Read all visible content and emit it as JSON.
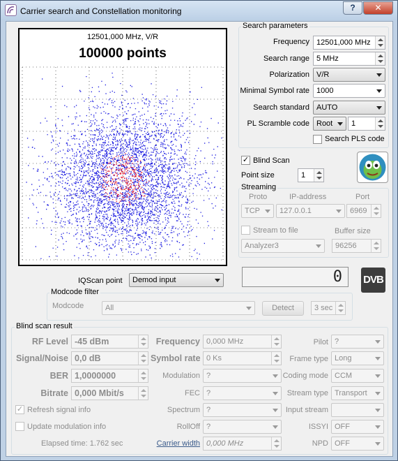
{
  "window": {
    "title": "Carrier search and Constellation monitoring",
    "help_label": "?",
    "close_label": "✕"
  },
  "plot": {
    "frequency_label": "12501,000 MHz, V/R",
    "points_label": "100000 points"
  },
  "search": {
    "legend": "Search parameters",
    "frequency_label": "Frequency",
    "frequency_value": "12501,000 MHz",
    "range_label": "Search range",
    "range_value": "5 MHz",
    "polarization_label": "Polarization",
    "polarization_value": "V/R",
    "symbol_rate_label": "Minimal Symbol rate",
    "symbol_rate_value": "1000",
    "standard_label": "Search standard",
    "standard_value": "AUTO",
    "pls_label": "PL Scramble code",
    "pls_mode": "Root",
    "pls_value": "1",
    "search_pls_label": "Search PLS code",
    "search_pls_checked": false
  },
  "blind_scan": {
    "label": "Blind Scan",
    "checked": true,
    "point_size_label": "Point size",
    "point_size_value": "1"
  },
  "streaming": {
    "legend": "Streaming",
    "proto_header": "Proto",
    "ip_header": "IP-address",
    "port_header": "Port",
    "proto_value": "TCP",
    "ip_value": "127.0.0.1",
    "port_value": "6969",
    "stream_to_file_label": "Stream to file",
    "stream_to_file_checked": false,
    "buffer_size_label": "Buffer size",
    "file_value": "Analyzer3",
    "buffer_value": "96256"
  },
  "iqscan": {
    "label": "IQScan point",
    "value": "Demod input"
  },
  "lcd": {
    "value": "0"
  },
  "dvb_logo": "DVB",
  "modcode": {
    "legend": "Modcode filter",
    "label": "Modcode",
    "value": "All",
    "detect_label": "Detect",
    "interval_value": "3 sec"
  },
  "result": {
    "legend": "Blind scan result",
    "rf_level_label": "RF Level",
    "rf_level_value": "-45 dBm",
    "snr_label": "Signal/Noise",
    "snr_value": "0,0 dB",
    "ber_label": "BER",
    "ber_value": "1,0000000",
    "bitrate_label": "Bitrate",
    "bitrate_value": "0,000 Mbit/s",
    "frequency_label": "Frequency",
    "frequency_value": "0,000 MHz",
    "symbol_rate_label": "Symbol rate",
    "symbol_rate_value": "0 Ks",
    "modulation_label": "Modulation",
    "modulation_value": "?",
    "fec_label": "FEC",
    "fec_value": "?",
    "spectrum_label": "Spectrum",
    "spectrum_value": "?",
    "rolloff_label": "RollOff",
    "rolloff_value": "?",
    "carrier_width_label": "Carrier width",
    "carrier_width_value": "0,000 MHz",
    "pilot_label": "Pilot",
    "pilot_value": "?",
    "frame_type_label": "Frame type",
    "frame_type_value": "Long",
    "coding_mode_label": "Coding mode",
    "coding_mode_value": "CCM",
    "stream_type_label": "Stream type",
    "stream_type_value": "Transport",
    "input_stream_label": "Input stream",
    "input_stream_value": "",
    "issyi_label": "ISSYI",
    "issyi_value": "OFF",
    "npd_label": "NPD",
    "npd_value": "OFF",
    "refresh_label": "Refresh signal info",
    "refresh_checked": true,
    "update_mod_label": "Update modulation info",
    "update_mod_checked": false,
    "elapsed_label": "Elapsed time: 1.762 sec"
  }
}
